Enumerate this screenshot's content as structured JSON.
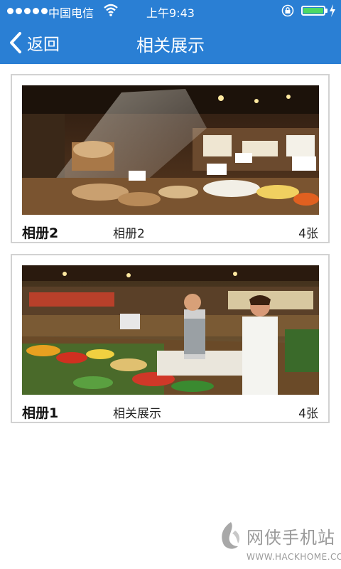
{
  "status_bar": {
    "carrier": "中国电信",
    "time": "上午9:43",
    "battery_level": 1.0,
    "colors": {
      "background": "#2a7fd4",
      "battery": "#4cd964"
    }
  },
  "nav": {
    "back_label": "返回",
    "title": "相关展示"
  },
  "albums": [
    {
      "name": "相册2",
      "description": "相册2",
      "count": "4张",
      "photo": "supermarket-deli-counter"
    },
    {
      "name": "相册1",
      "description": "相关展示",
      "count": "4张",
      "photo": "supermarket-produce-staff"
    }
  ],
  "watermark": {
    "text": "网侠手机站",
    "url": "WWW.HACKHOME.COM"
  }
}
